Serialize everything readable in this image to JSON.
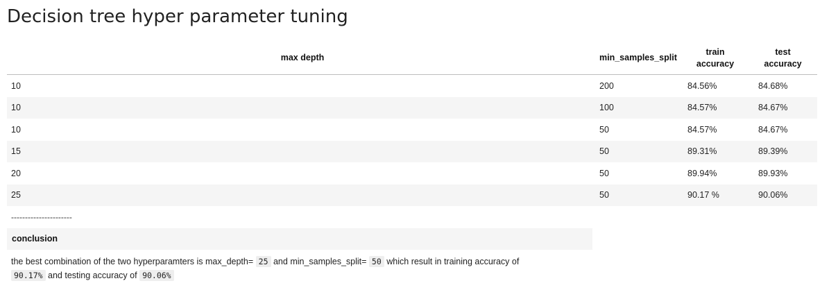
{
  "title": "Decision tree hyper parameter tuning",
  "table": {
    "headers": {
      "max_depth": "max depth",
      "min_samples_split": "min_samples_split",
      "train_accuracy_line1": "train",
      "train_accuracy_line2": "accuracy",
      "test_accuracy_line1": "test",
      "test_accuracy_line2": "accuracy"
    },
    "rows": [
      {
        "max_depth": "10",
        "min_samples_split": "200",
        "train_accuracy": "84.56%",
        "test_accuracy": "84.68%"
      },
      {
        "max_depth": "10",
        "min_samples_split": "100",
        "train_accuracy": "84.57%",
        "test_accuracy": "84.67%"
      },
      {
        "max_depth": "10",
        "min_samples_split": "50",
        "train_accuracy": "84.57%",
        "test_accuracy": "84.67%"
      },
      {
        "max_depth": "15",
        "min_samples_split": "50",
        "train_accuracy": "89.31%",
        "test_accuracy": "89.39%"
      },
      {
        "max_depth": "20",
        "min_samples_split": "50",
        "train_accuracy": "89.94%",
        "test_accuracy": "89.93%"
      },
      {
        "max_depth": "25",
        "min_samples_split": "50",
        "train_accuracy": "90.17 %",
        "test_accuracy": "90.06%"
      }
    ]
  },
  "separator": "----------------------",
  "conclusion": {
    "heading": "conclusion",
    "text_part1": "the best combination of the two hyperparamters is max_depth=",
    "code_max_depth": "25",
    "text_part2": "and min_samples_split=",
    "code_min_samples_split": "50",
    "text_part3": "which result in training accuracy of",
    "code_train_accuracy": "90.17%",
    "text_part4": "and testing accuracy of",
    "code_test_accuracy": "90.06%"
  }
}
